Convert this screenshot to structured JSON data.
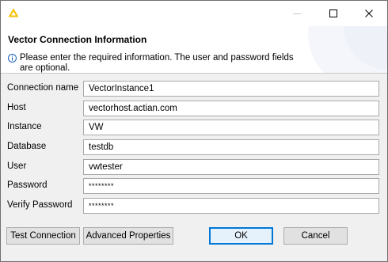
{
  "window": {
    "controls": {
      "minimize": "—",
      "maximize": "☐",
      "close": "✕"
    }
  },
  "header": {
    "title": "Vector Connection Information",
    "info": "Please enter the required information. The user and password fields are optional."
  },
  "form": {
    "connection_name": {
      "label": "Connection name",
      "value": "VectorInstance1"
    },
    "host": {
      "label": "Host",
      "value": "vectorhost.actian.com"
    },
    "instance": {
      "label": "Instance",
      "value": "VW"
    },
    "database": {
      "label": "Database",
      "value": "testdb"
    },
    "user": {
      "label": "User",
      "value": "vwtester"
    },
    "password": {
      "label": "Password",
      "value": "********"
    },
    "verify_password": {
      "label": "Verify Password",
      "value": "********"
    }
  },
  "buttons": {
    "test_connection": "Test Connection",
    "advanced_properties": "Advanced Properties",
    "ok": "OK",
    "cancel": "Cancel"
  },
  "colors": {
    "app_icon": "#f2c200",
    "accent": "#0078d7",
    "info_icon": "#1a5fb4"
  },
  "icons": {
    "app": "warning-triangle-icon",
    "info": "info-icon"
  }
}
